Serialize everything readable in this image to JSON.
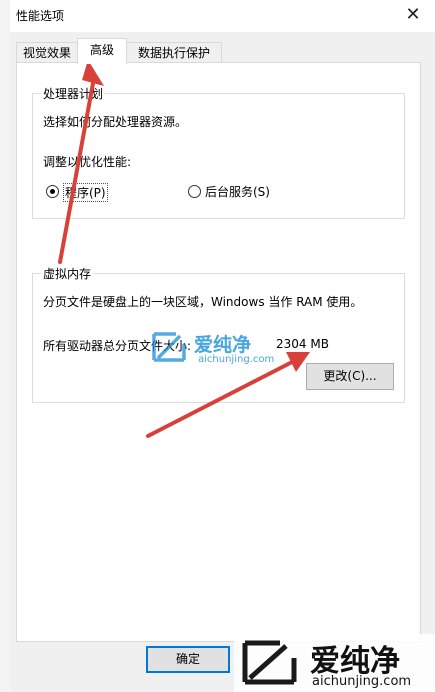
{
  "window": {
    "title": "性能选项",
    "close_glyph": "✕"
  },
  "tabs": [
    {
      "label": "视觉效果"
    },
    {
      "label": "高级"
    },
    {
      "label": "数据执行保护"
    }
  ],
  "processor": {
    "legend": "处理器计划",
    "description": "选择如何分配处理器资源。",
    "adjust_label": "调整以优化性能:",
    "options": [
      {
        "label": "程序(P)",
        "selected": true
      },
      {
        "label": "后台服务(S)",
        "selected": false
      }
    ]
  },
  "virtual_memory": {
    "legend": "虚拟内存",
    "description": "分页文件是硬盘上的一块区域，Windows 当作 RAM 使用。",
    "total_label": "所有驱动器总分页文件大小:",
    "total_value": "2304 MB",
    "change_label": "更改(C)..."
  },
  "footer": {
    "ok_label": "确定"
  },
  "watermark": {
    "brand": "爱纯净",
    "url": "aichunjing.com"
  },
  "colors": {
    "arrow": "#d8413a",
    "watermark_blue": "#1a8fd8"
  }
}
